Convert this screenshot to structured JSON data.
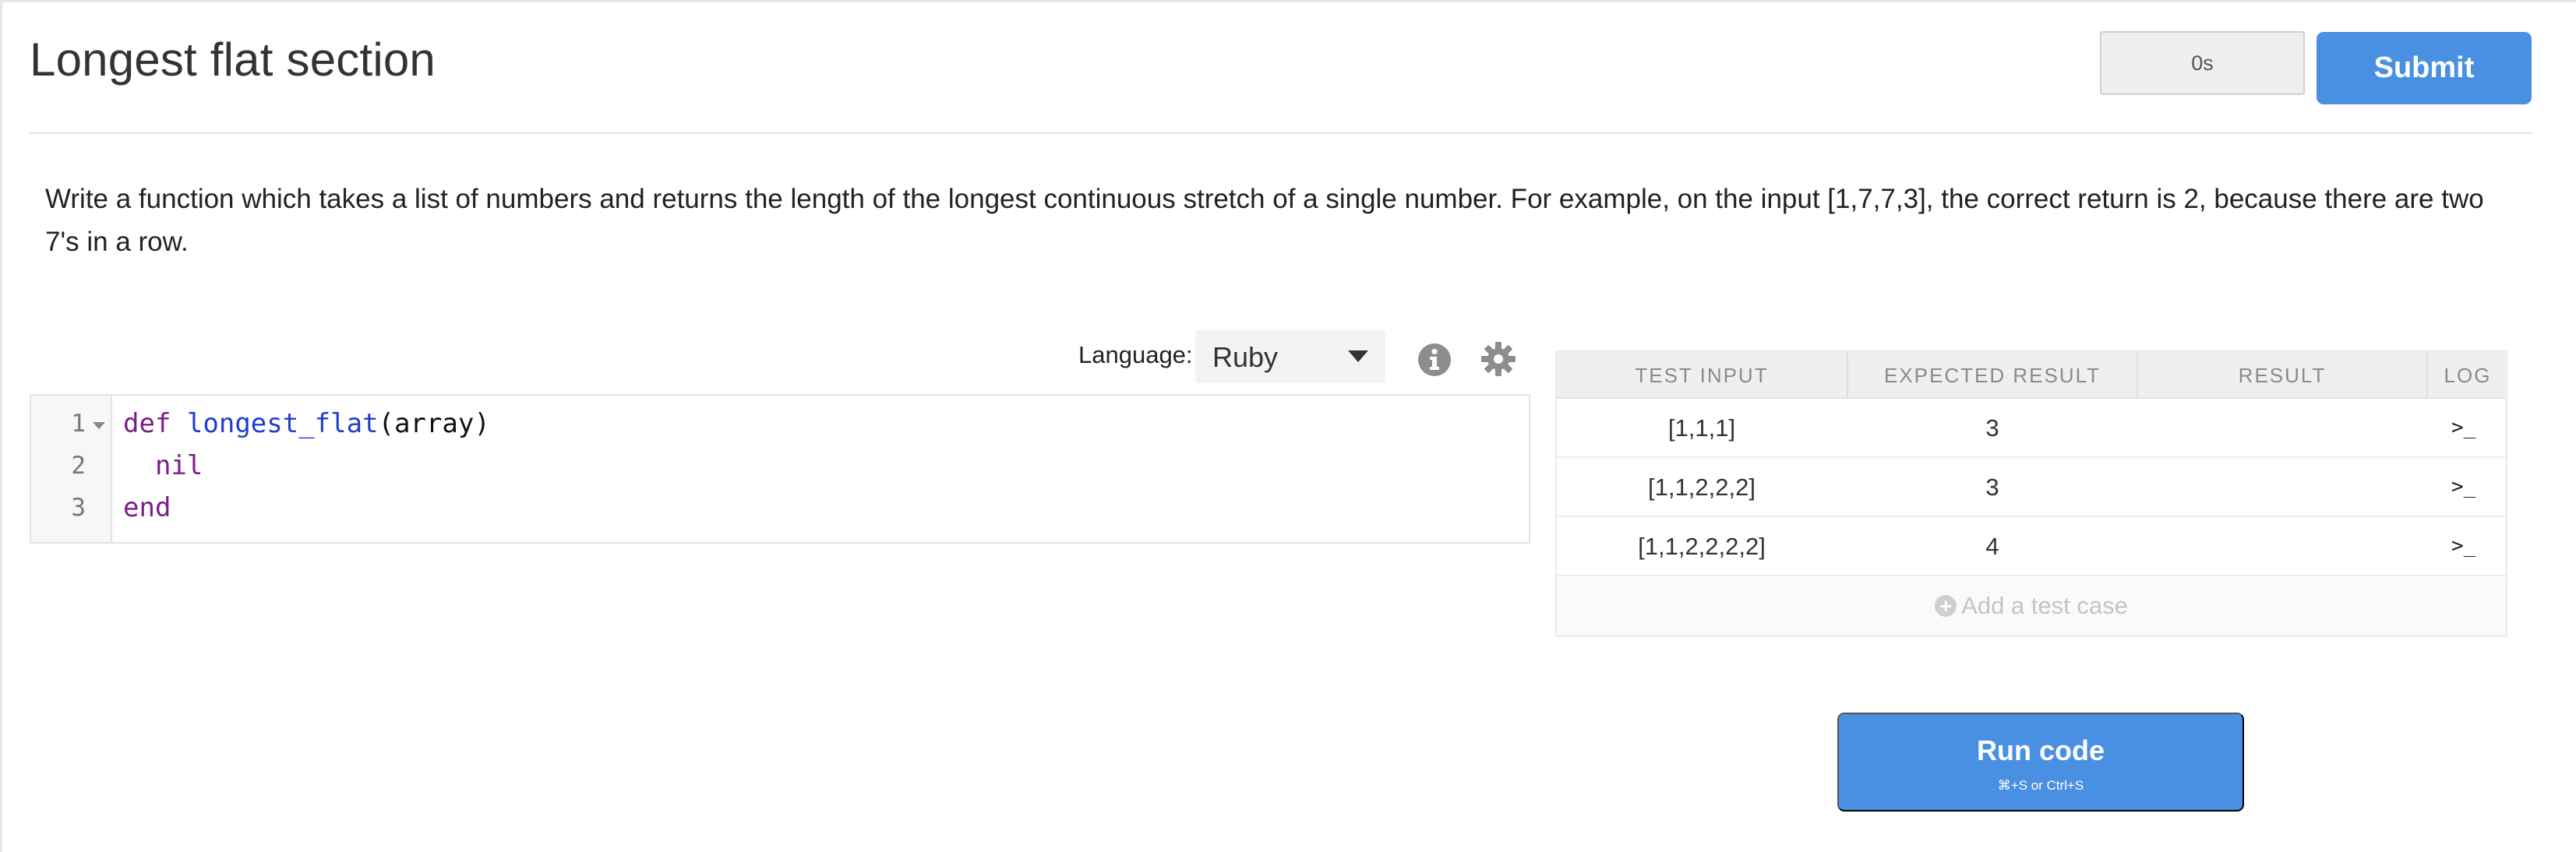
{
  "header": {
    "title": "Longest flat section",
    "timer": "0s",
    "submit_label": "Submit"
  },
  "prompt": {
    "text": "Write a function which takes a list of numbers and returns the length of the longest continuous stretch of a single number. For example, on the input [1,7,7,3], the correct return is 2, because there are two 7's in a row."
  },
  "editor_toolbar": {
    "language_label": "Language:",
    "language_value": "Ruby",
    "info_icon": "info-icon",
    "settings_icon": "gear-icon"
  },
  "editor": {
    "line_numbers": [
      "1",
      "2",
      "3"
    ],
    "lines": [
      {
        "kw": "def",
        "fn": "longest_flat",
        "rest": "(array)"
      },
      {
        "kw": "nil"
      },
      {
        "kw": "end"
      }
    ]
  },
  "tests": {
    "headers": [
      "TEST INPUT",
      "EXPECTED RESULT",
      "RESULT",
      "LOG"
    ],
    "rows": [
      {
        "input": "[1,1,1]",
        "expected": "3",
        "result": "",
        "log": ">_"
      },
      {
        "input": "[1,1,2,2,2]",
        "expected": "3",
        "result": "",
        "log": ">_"
      },
      {
        "input": "[1,1,2,2,2,2]",
        "expected": "4",
        "result": "",
        "log": ">_"
      }
    ],
    "add_label": "Add a test case",
    "add_icon": "plus-circle-icon"
  },
  "run": {
    "label": "Run code",
    "hint": "⌘+S or Ctrl+S"
  },
  "colors": {
    "accent": "#4a90e2",
    "keyword": "#7a1e86",
    "function_name": "#1f3ecc"
  }
}
